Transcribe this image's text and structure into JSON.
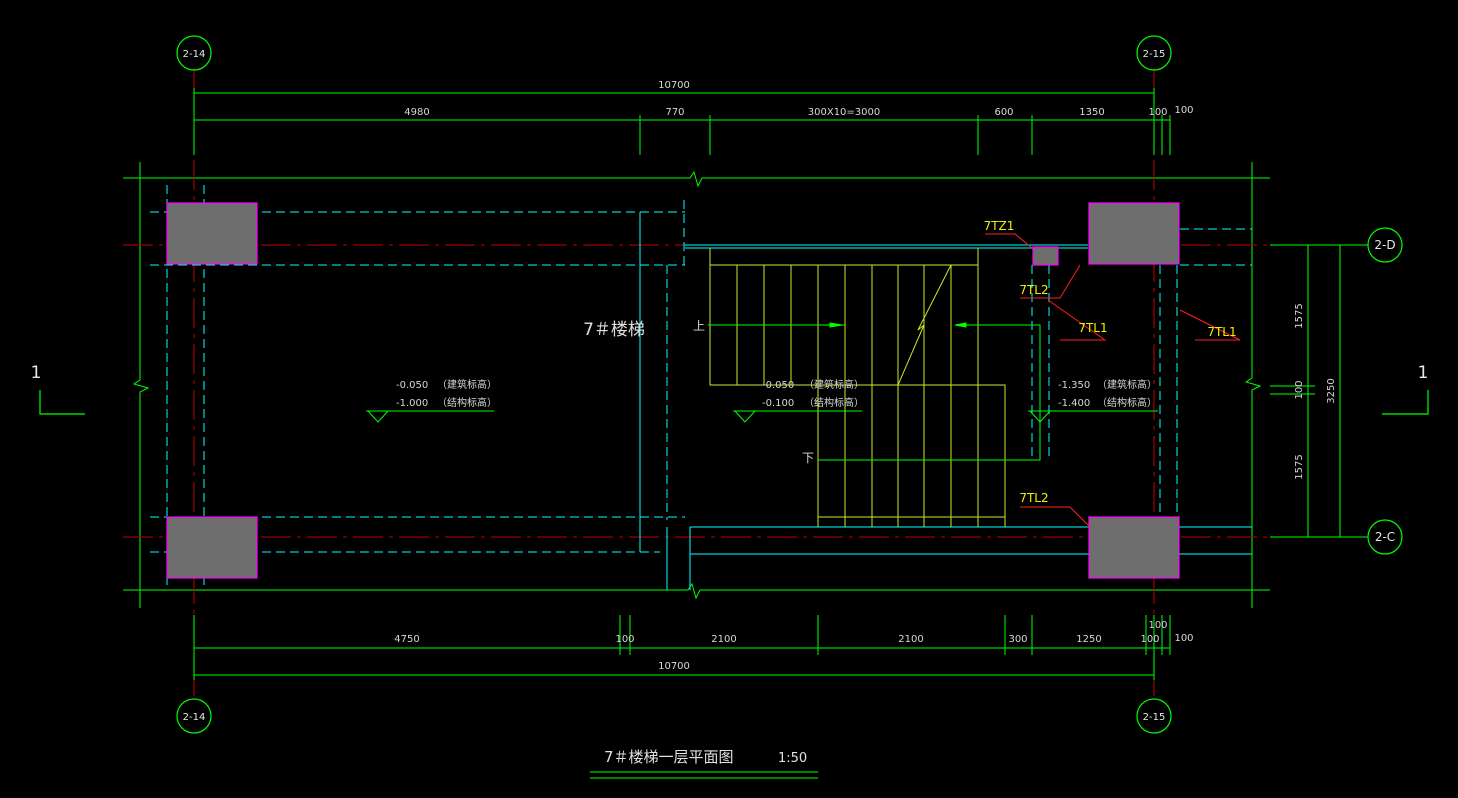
{
  "grid_labels": {
    "top_left": "2-14",
    "top_right": "2-15",
    "bottom_left": "2-14",
    "bottom_right": "2-15",
    "right_top": "2-D",
    "right_bottom": "2-C"
  },
  "top_dimensions": {
    "overall": "10700",
    "d1": "4980",
    "d2": "770",
    "d3": "300X10=3000",
    "d4": "600",
    "d5": "1350",
    "d6": "100",
    "d7": "100"
  },
  "bottom_dimensions": {
    "overall": "10700",
    "d1": "4750",
    "d2": "100",
    "d3": "2100",
    "d4": "2100",
    "d5": "300",
    "d6": "1250",
    "d7": "100",
    "d8": "100",
    "d9": "100"
  },
  "right_dimensions": {
    "d1": "1575",
    "d2": "100",
    "d3": "1575",
    "overall": "3250"
  },
  "section_marks": {
    "left": "1",
    "right": "1"
  },
  "labels": {
    "stair_name": "7＃楼梯",
    "up": "上",
    "down": "下",
    "tz1": "7TZ1",
    "tl2_top": "7TL2",
    "tl1_mid": "7TL1",
    "tl1_right": "7TL1",
    "tl2_bottom": "7TL2"
  },
  "elevations": {
    "left": {
      "arch": "-0.050",
      "arch_note": "（建筑标高）",
      "struct": "-1.000",
      "struct_note": "（结构标高）"
    },
    "middle": {
      "arch": "-0.050",
      "arch_note": "（建筑标高）",
      "struct": "-0.100",
      "struct_note": "（结构标高）"
    },
    "right": {
      "arch": "-1.350",
      "arch_note": "（建筑标高）",
      "struct": "-1.400",
      "struct_note": "（结构标高）"
    }
  },
  "title": {
    "text": "7＃楼梯一层平面图",
    "scale": "1:50"
  },
  "colors": {
    "background": "#000000",
    "dimension_green": "#00ff00",
    "axis_red": "#c00000",
    "beam_cyan": "#00ffff",
    "column_fill": "#6e6e6e",
    "column_magenta": "#ff00ff",
    "stair_yellow_green": "#c8e830",
    "label_yellow": "#ffff00"
  }
}
